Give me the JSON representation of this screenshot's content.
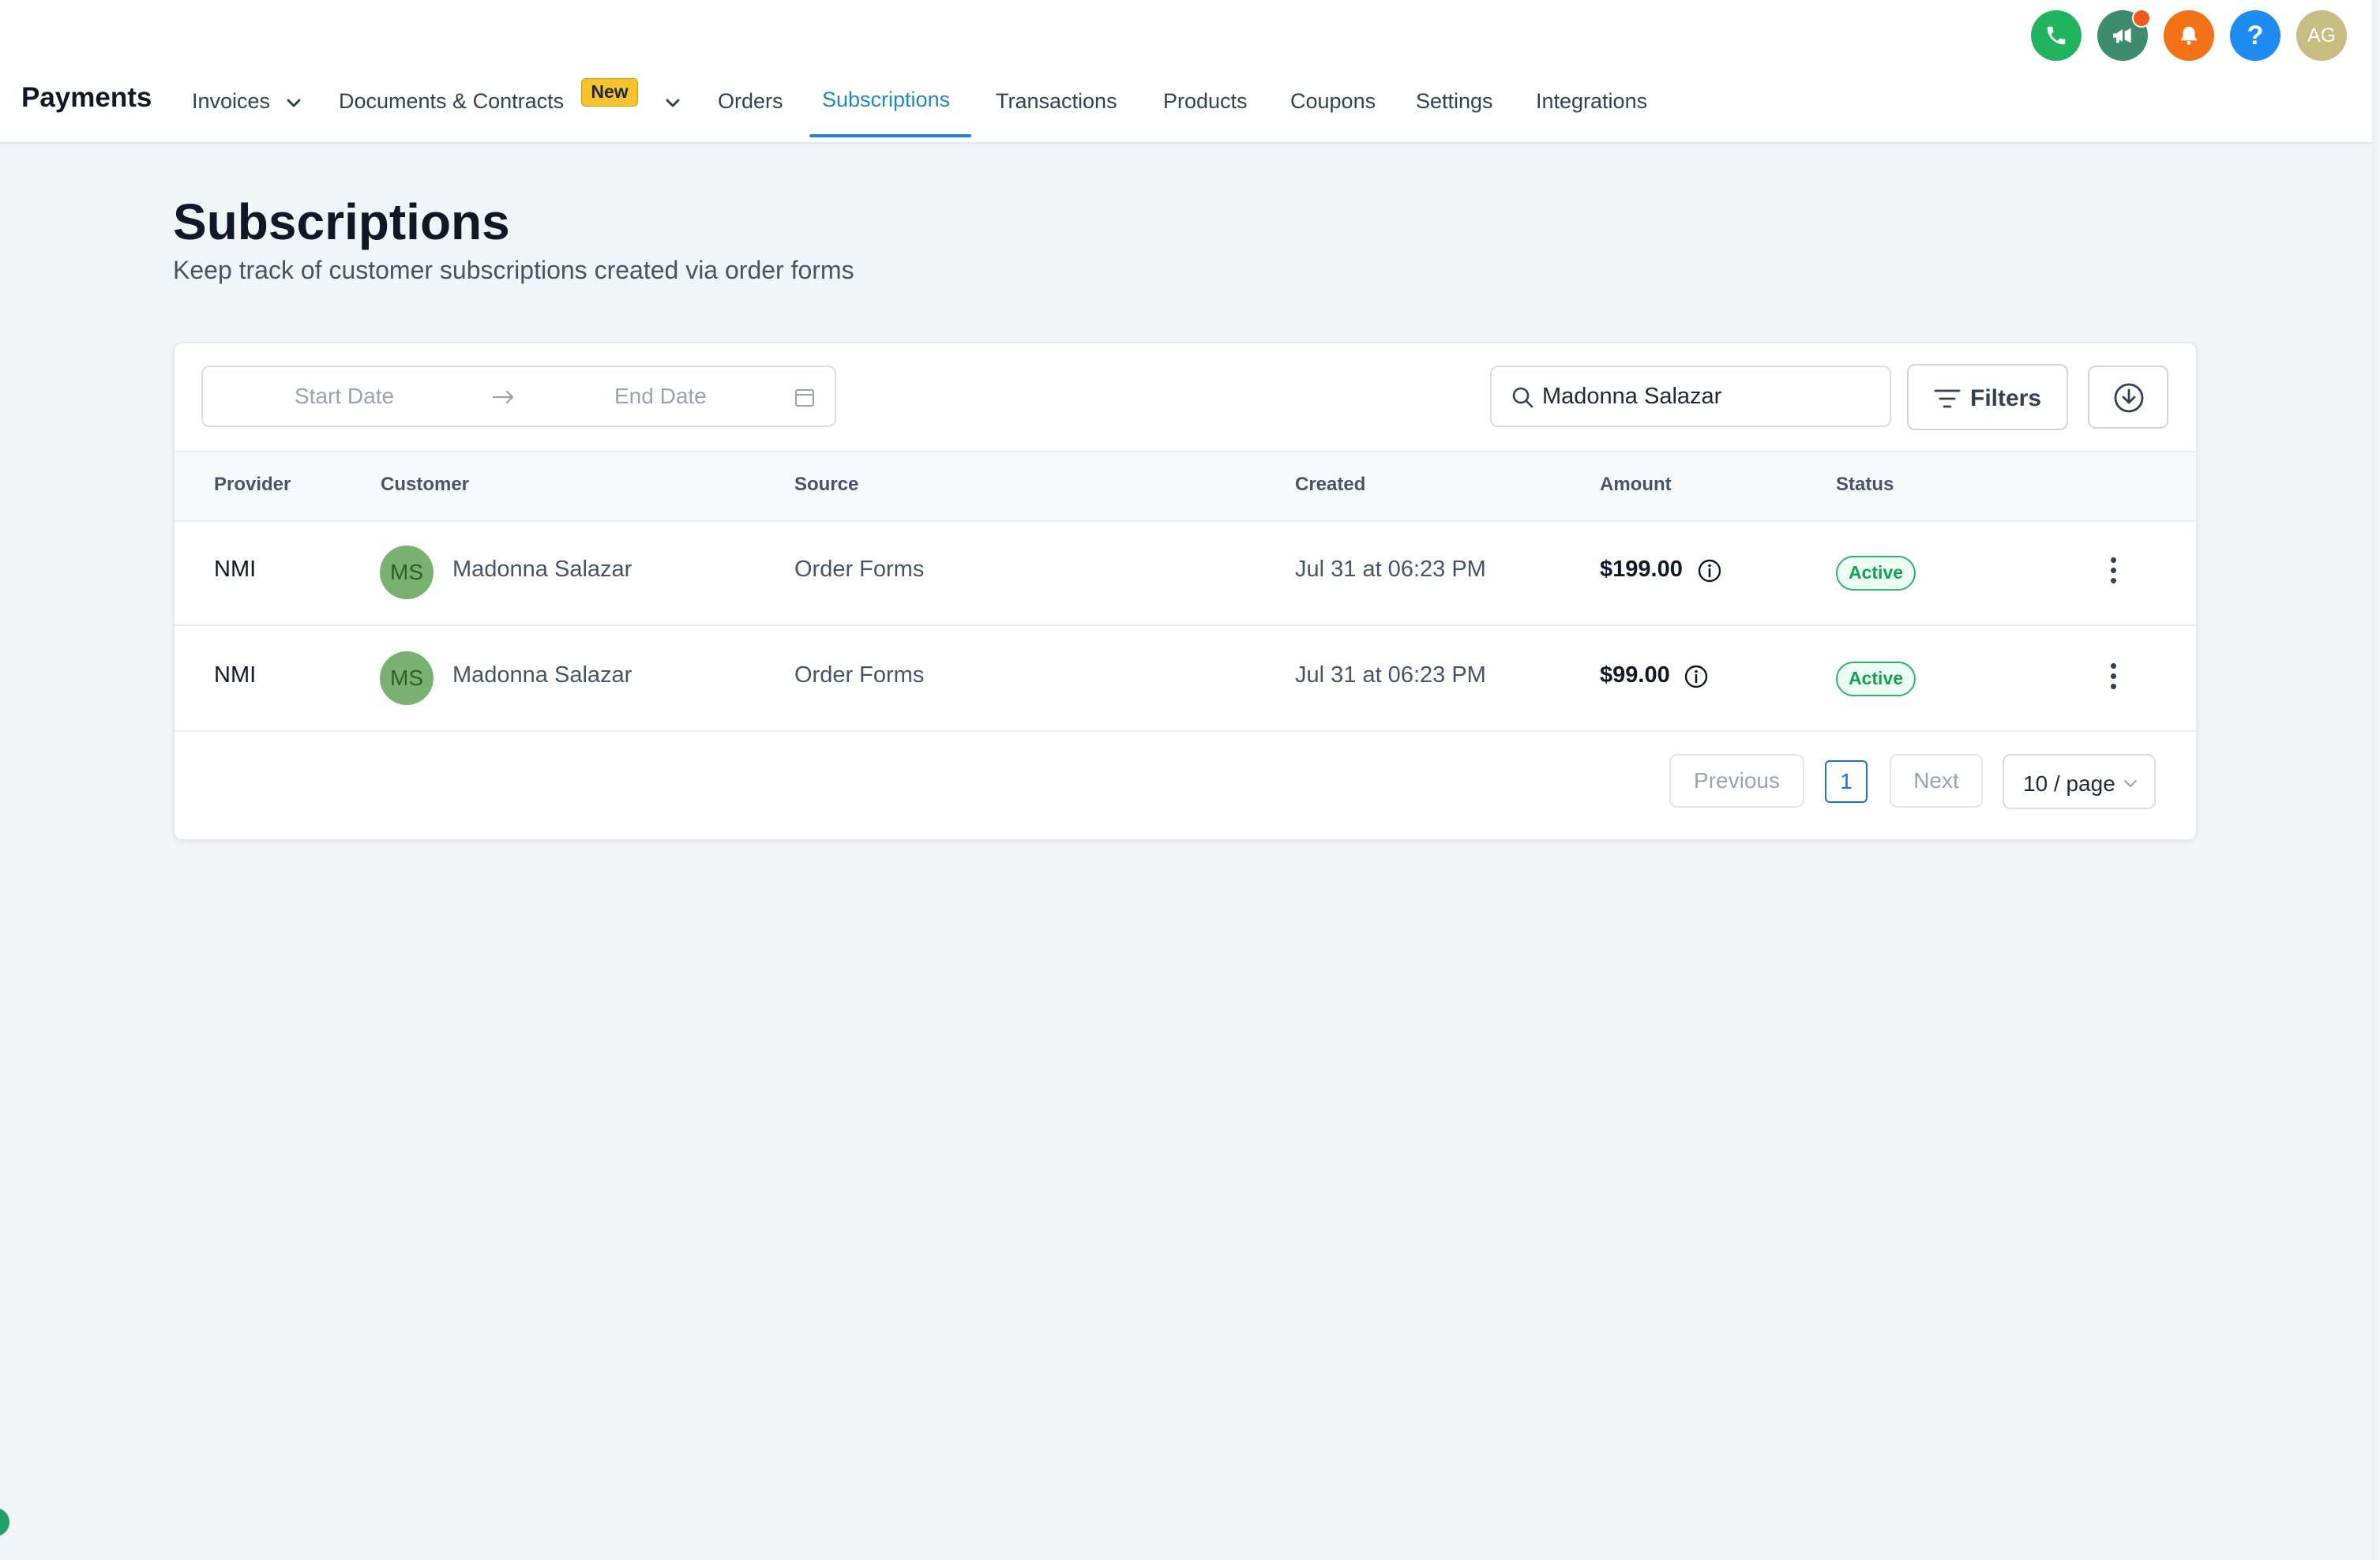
{
  "header": {
    "brand": "Payments",
    "nav": [
      {
        "label": "Invoices",
        "has_dropdown": true
      },
      {
        "label": "Documents & Contracts",
        "badge": "New",
        "has_dropdown": true
      },
      {
        "label": "Orders"
      },
      {
        "label": "Subscriptions",
        "active": true
      },
      {
        "label": "Transactions"
      },
      {
        "label": "Products"
      },
      {
        "label": "Coupons"
      },
      {
        "label": "Settings"
      },
      {
        "label": "Integrations"
      }
    ],
    "top_icons": [
      {
        "name": "phone-icon",
        "color": "#22b35e"
      },
      {
        "name": "megaphone-icon",
        "color": "#3d8c6d"
      },
      {
        "name": "bell-icon",
        "color": "#f47116"
      },
      {
        "name": "help-icon",
        "color": "#1d8bf1"
      }
    ],
    "user_initials": "AG"
  },
  "page": {
    "title": "Subscriptions",
    "subtitle": "Keep track of customer subscriptions created via order forms"
  },
  "toolbar": {
    "start_date_placeholder": "Start Date",
    "end_date_placeholder": "End Date",
    "search_value": "Madonna Salazar",
    "filters_label": "Filters"
  },
  "table": {
    "columns": [
      "Provider",
      "Customer",
      "Source",
      "Created",
      "Amount",
      "Status"
    ],
    "rows": [
      {
        "provider": "NMI",
        "initials": "MS",
        "customer": "Madonna Salazar",
        "source": "Order Forms",
        "created": "Jul 31 at 06:23 PM",
        "amount": "$199.00",
        "status": "Active"
      },
      {
        "provider": "NMI",
        "initials": "MS",
        "customer": "Madonna Salazar",
        "source": "Order Forms",
        "created": "Jul 31 at 06:23 PM",
        "amount": "$99.00",
        "status": "Active"
      }
    ]
  },
  "pagination": {
    "previous": "Previous",
    "current_page": "1",
    "next": "Next",
    "page_size": "10 / page"
  },
  "colors": {
    "accent": "#1d87c8",
    "status_active": "#17a055",
    "badge_new": "#f6c32e"
  }
}
